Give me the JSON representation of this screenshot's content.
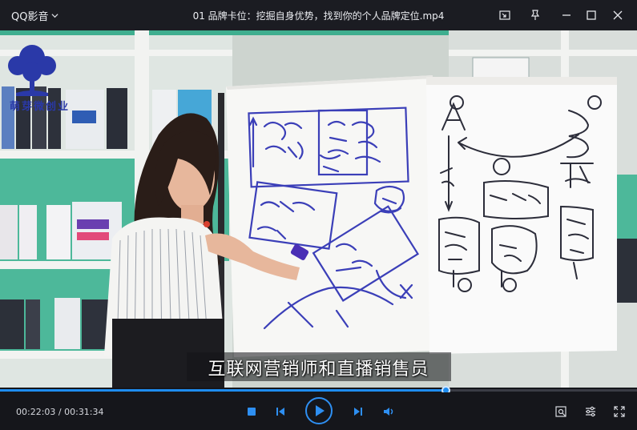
{
  "titlebar": {
    "app_name": "QQ影音",
    "file_title": "01 品牌卡位：挖掘自身优势，找到你的个人品牌定位.mp4"
  },
  "video": {
    "subtitle": "互联网营销师和直播销售员",
    "logo_text": "萌芽微创业"
  },
  "playback": {
    "current_time": "00:22:03",
    "total_time": "00:31:34",
    "time_separator": " / ",
    "progress_fraction": 0.699
  },
  "colors": {
    "accent": "#1e8cf0",
    "titlebar_bg": "#1b1c22",
    "controls_bg": "#15161b"
  },
  "icons": {
    "title_dropdown": "chevron-down-icon",
    "pip": "picture-in-picture-icon",
    "pin": "pin-icon",
    "minimize": "minimize-icon",
    "maximize": "maximize-icon",
    "close": "close-icon",
    "stop": "stop-icon",
    "previous": "previous-icon",
    "play": "play-icon",
    "next": "next-icon",
    "volume": "volume-icon",
    "screenshot": "screenshot-icon",
    "settings": "settings-icon",
    "fullscreen": "fullscreen-icon"
  }
}
